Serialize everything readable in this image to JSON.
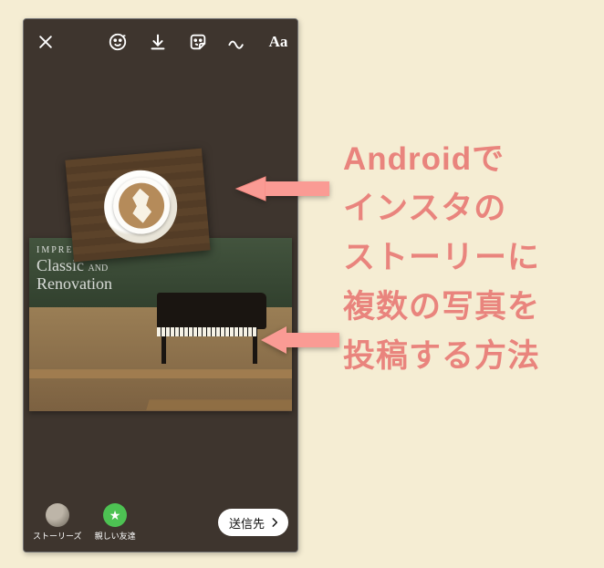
{
  "toolbar": {
    "close_name": "close",
    "tools": {
      "effects_name": "effects",
      "download_name": "download",
      "sticker_name": "sticker",
      "draw_name": "draw",
      "text_tool_label": "Aa"
    }
  },
  "bottom_bar": {
    "stories_label": "ストーリーズ",
    "close_friends_label": "親しい友達",
    "send_to_label": "送信先"
  },
  "caption_lines": [
    "Androidで",
    "インスタの",
    "ストーリーに",
    "複数の写真を",
    "投稿する方法"
  ],
  "bg_photo_text": {
    "line1": "IMPRESSION",
    "line2": "Classic",
    "line3": "Renovation"
  },
  "arrow_color": "#FA9B94"
}
